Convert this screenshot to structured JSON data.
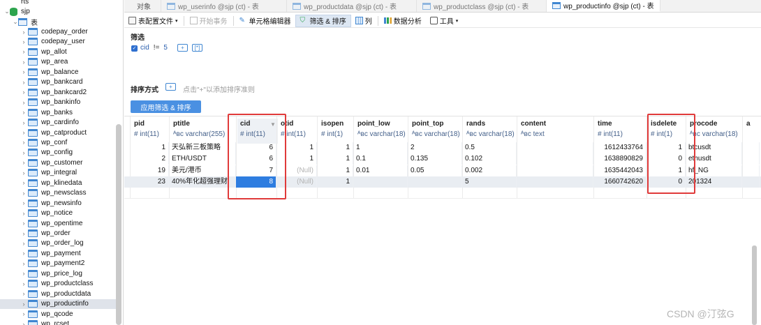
{
  "sidebar": {
    "top_items": [
      {
        "label": "rts",
        "kind": "db"
      },
      {
        "label": "sjp",
        "kind": "db"
      },
      {
        "label": "表",
        "kind": "group"
      }
    ],
    "tables": [
      "codepay_order",
      "codepay_user",
      "wp_allot",
      "wp_area",
      "wp_balance",
      "wp_bankcard",
      "wp_bankcard2",
      "wp_bankinfo",
      "wp_banks",
      "wp_cardinfo",
      "wp_catproduct",
      "wp_conf",
      "wp_config",
      "wp_customer",
      "wp_integral",
      "wp_klinedata",
      "wp_newsclass",
      "wp_newsinfo",
      "wp_notice",
      "wp_opentime",
      "wp_order",
      "wp_order_log",
      "wp_payment",
      "wp_payment2",
      "wp_price_log",
      "wp_productclass",
      "wp_productdata",
      "wp_productinfo",
      "wp_qcode",
      "wp_rcset"
    ],
    "selected": "wp_productinfo"
  },
  "tabs": [
    {
      "label": "对象",
      "active": false,
      "icon": false
    },
    {
      "label": "wp_userinfo @sjp (ct) - 表",
      "active": false,
      "icon": true
    },
    {
      "label": "wp_productdata @sjp (ct) - 表",
      "active": false,
      "icon": true
    },
    {
      "label": "wp_productclass @sjp (ct) - 表",
      "active": false,
      "icon": true
    },
    {
      "label": "wp_productinfo @sjp (ct) - 表",
      "active": true,
      "icon": true
    }
  ],
  "toolbar": {
    "config_file": "表配置文件",
    "begin_txn": "开始事务",
    "cell_editor": "单元格编辑器",
    "filter_sort": "筛选 & 排序",
    "columns": "列",
    "data_analysis": "数据分析",
    "tools": "工具"
  },
  "filter": {
    "title": "筛选",
    "field": "cid",
    "operator": "!=",
    "value": "5",
    "add_btn": "+",
    "bracket_btn": "[*]"
  },
  "sort": {
    "title": "排序方式",
    "add_btn": "+",
    "hint": "点击\"+\"以添加排序准则"
  },
  "apply_button": "应用筛选 & 排序",
  "grid": {
    "columns": [
      {
        "name": "pid",
        "type": "int(11)",
        "kind": "num"
      },
      {
        "name": "ptitle",
        "type": "varchar(255)",
        "kind": "str"
      },
      {
        "name": "cid",
        "type": "int(11)",
        "kind": "num"
      },
      {
        "name": "otid",
        "type": "int(11)",
        "kind": "num"
      },
      {
        "name": "isopen",
        "type": "int(1)",
        "kind": "num"
      },
      {
        "name": "point_low",
        "type": "varchar(18)",
        "kind": "str"
      },
      {
        "name": "point_top",
        "type": "varchar(18)",
        "kind": "str"
      },
      {
        "name": "rands",
        "type": "varchar(18)",
        "kind": "str"
      },
      {
        "name": "content",
        "type": "text",
        "kind": "str"
      },
      {
        "name": "time",
        "type": "int(11)",
        "kind": "num"
      },
      {
        "name": "isdelete",
        "type": "int(1)",
        "kind": "num"
      },
      {
        "name": "procode",
        "type": "varchar(18)",
        "kind": "str"
      },
      {
        "name": "a",
        "type": "",
        "kind": "str"
      }
    ],
    "rows": [
      [
        "1",
        "天弘新三板策略",
        "6",
        "1",
        "1",
        "1",
        "2",
        "0.5",
        "",
        "1612433764",
        "1",
        "btcusdt",
        ""
      ],
      [
        "2",
        "ETH/USDT",
        "6",
        "1",
        "1",
        "0.1",
        "0.135",
        "0.102",
        "",
        "1638890829",
        "0",
        "ethusdt",
        ""
      ],
      [
        "19",
        "美元/港币",
        "7",
        "(Null)",
        "1",
        "0.01",
        "0.05",
        "0.002",
        "",
        "1635442043",
        "1",
        "hf_NG",
        ""
      ],
      [
        "23",
        "40%年化超强理财",
        "8",
        "(Null)",
        "1",
        "",
        "",
        "5",
        "",
        "1660742620",
        "0",
        "201324",
        ""
      ]
    ]
  },
  "watermark": "CSDN @汀弦G",
  "colors": {
    "accent": "#4a90e2",
    "highlight": "#e03a3a",
    "selected_cell": "#2e7de0"
  }
}
